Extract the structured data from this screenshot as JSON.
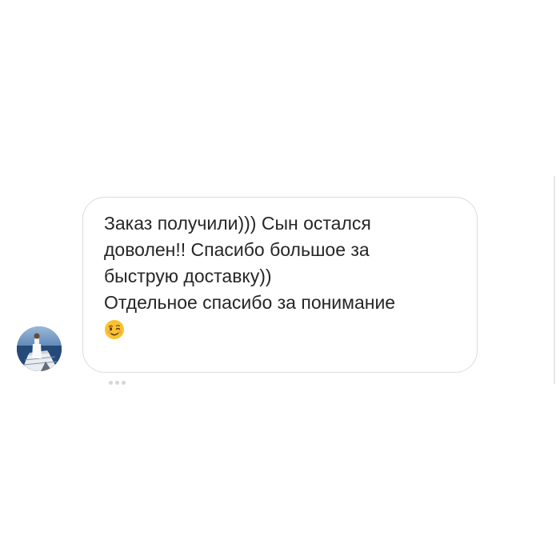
{
  "message": {
    "lines": [
      "Заказ получили))) Сын остался",
      "доволен!! Спасибо большое за",
      "быструю доставку))",
      "Отдельное спасибо за понимание"
    ],
    "emoji_icon": "winking-face-emoji"
  },
  "sender": {
    "avatar_icon": "profile-photo-boat-sea"
  },
  "colors": {
    "text": "#262626",
    "bubble_border": "#dcdcdc",
    "background": "#ffffff",
    "emoji_face": "#f9c22e"
  }
}
